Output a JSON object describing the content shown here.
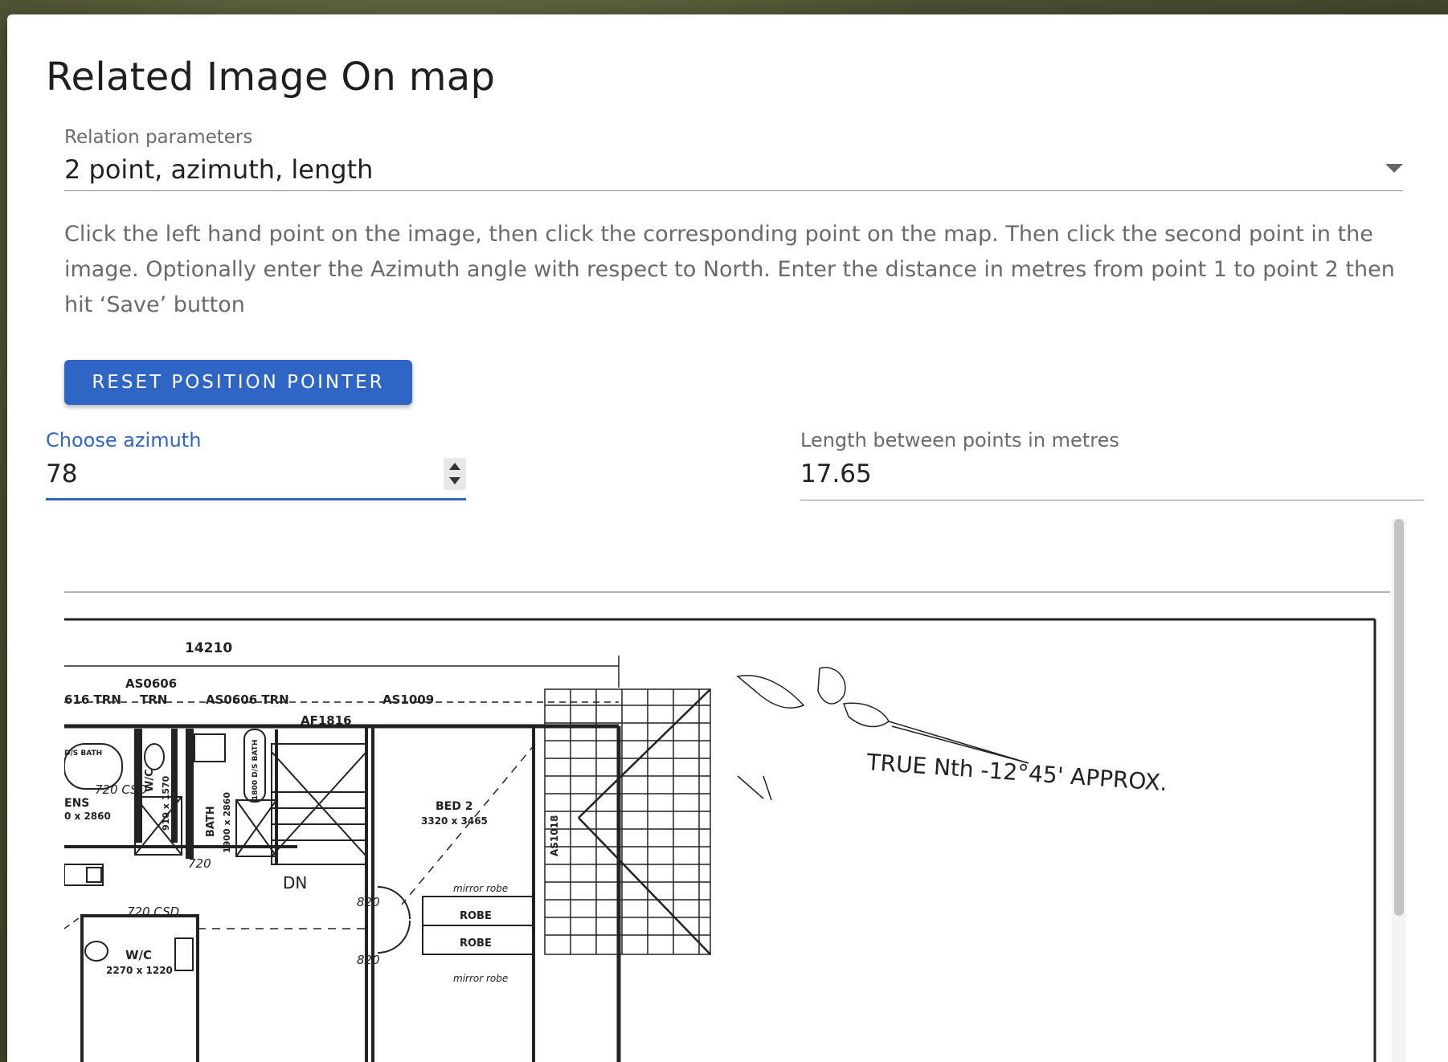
{
  "dialog": {
    "title": "Related Image On map",
    "relation": {
      "label": "Relation parameters",
      "selected": "2 point, azimuth, length"
    },
    "instructions": "Click the left hand point on the image, then click the corresponding point on the map. Then click the second point in the image. Optionally enter the Azimuth angle with respect to North. Enter the distance in metres from point 1 to point 2 then hit ‘Save’ button",
    "reset_button": "RESET POSITION POINTER",
    "azimuth": {
      "label": "Choose azimuth",
      "value": "78"
    },
    "length": {
      "label": "Length between points in metres",
      "value": "17.65"
    }
  },
  "plan": {
    "north_note": "TRUE Nth -12°45' APPROX.",
    "dimension_top": "14210",
    "labels": {
      "w_616": "616 TRN",
      "w_as0606": "AS0606",
      "w_trn": "TRN",
      "w_as0606_trn": "AS0606 TRN",
      "w_as1009": "AS1009",
      "w_af1816": "AF1816",
      "bath_small": "D/S BATH",
      "wc": "W/C",
      "wc_size": "910 x 1570",
      "csd_720": "720 CSD",
      "ens": "ENS",
      "ens_size": "0 x 2860",
      "bath": "BATH",
      "bath_size": "1900 x 2860",
      "bath2": "1800 D/S BATH",
      "d720": "720",
      "dn": "DN",
      "bed2": "BED 2",
      "bed2_size": "3320 x 3465",
      "as1018": "AS1018",
      "d820a": "820",
      "d820b": "820",
      "mirror_a": "mirror robe",
      "robe_a": "ROBE",
      "robe_b": "ROBE",
      "mirror_b": "mirror robe",
      "csd_720b": "720 CSD",
      "wc2": "W/C",
      "wc2_size": "2270 x 1220"
    }
  }
}
